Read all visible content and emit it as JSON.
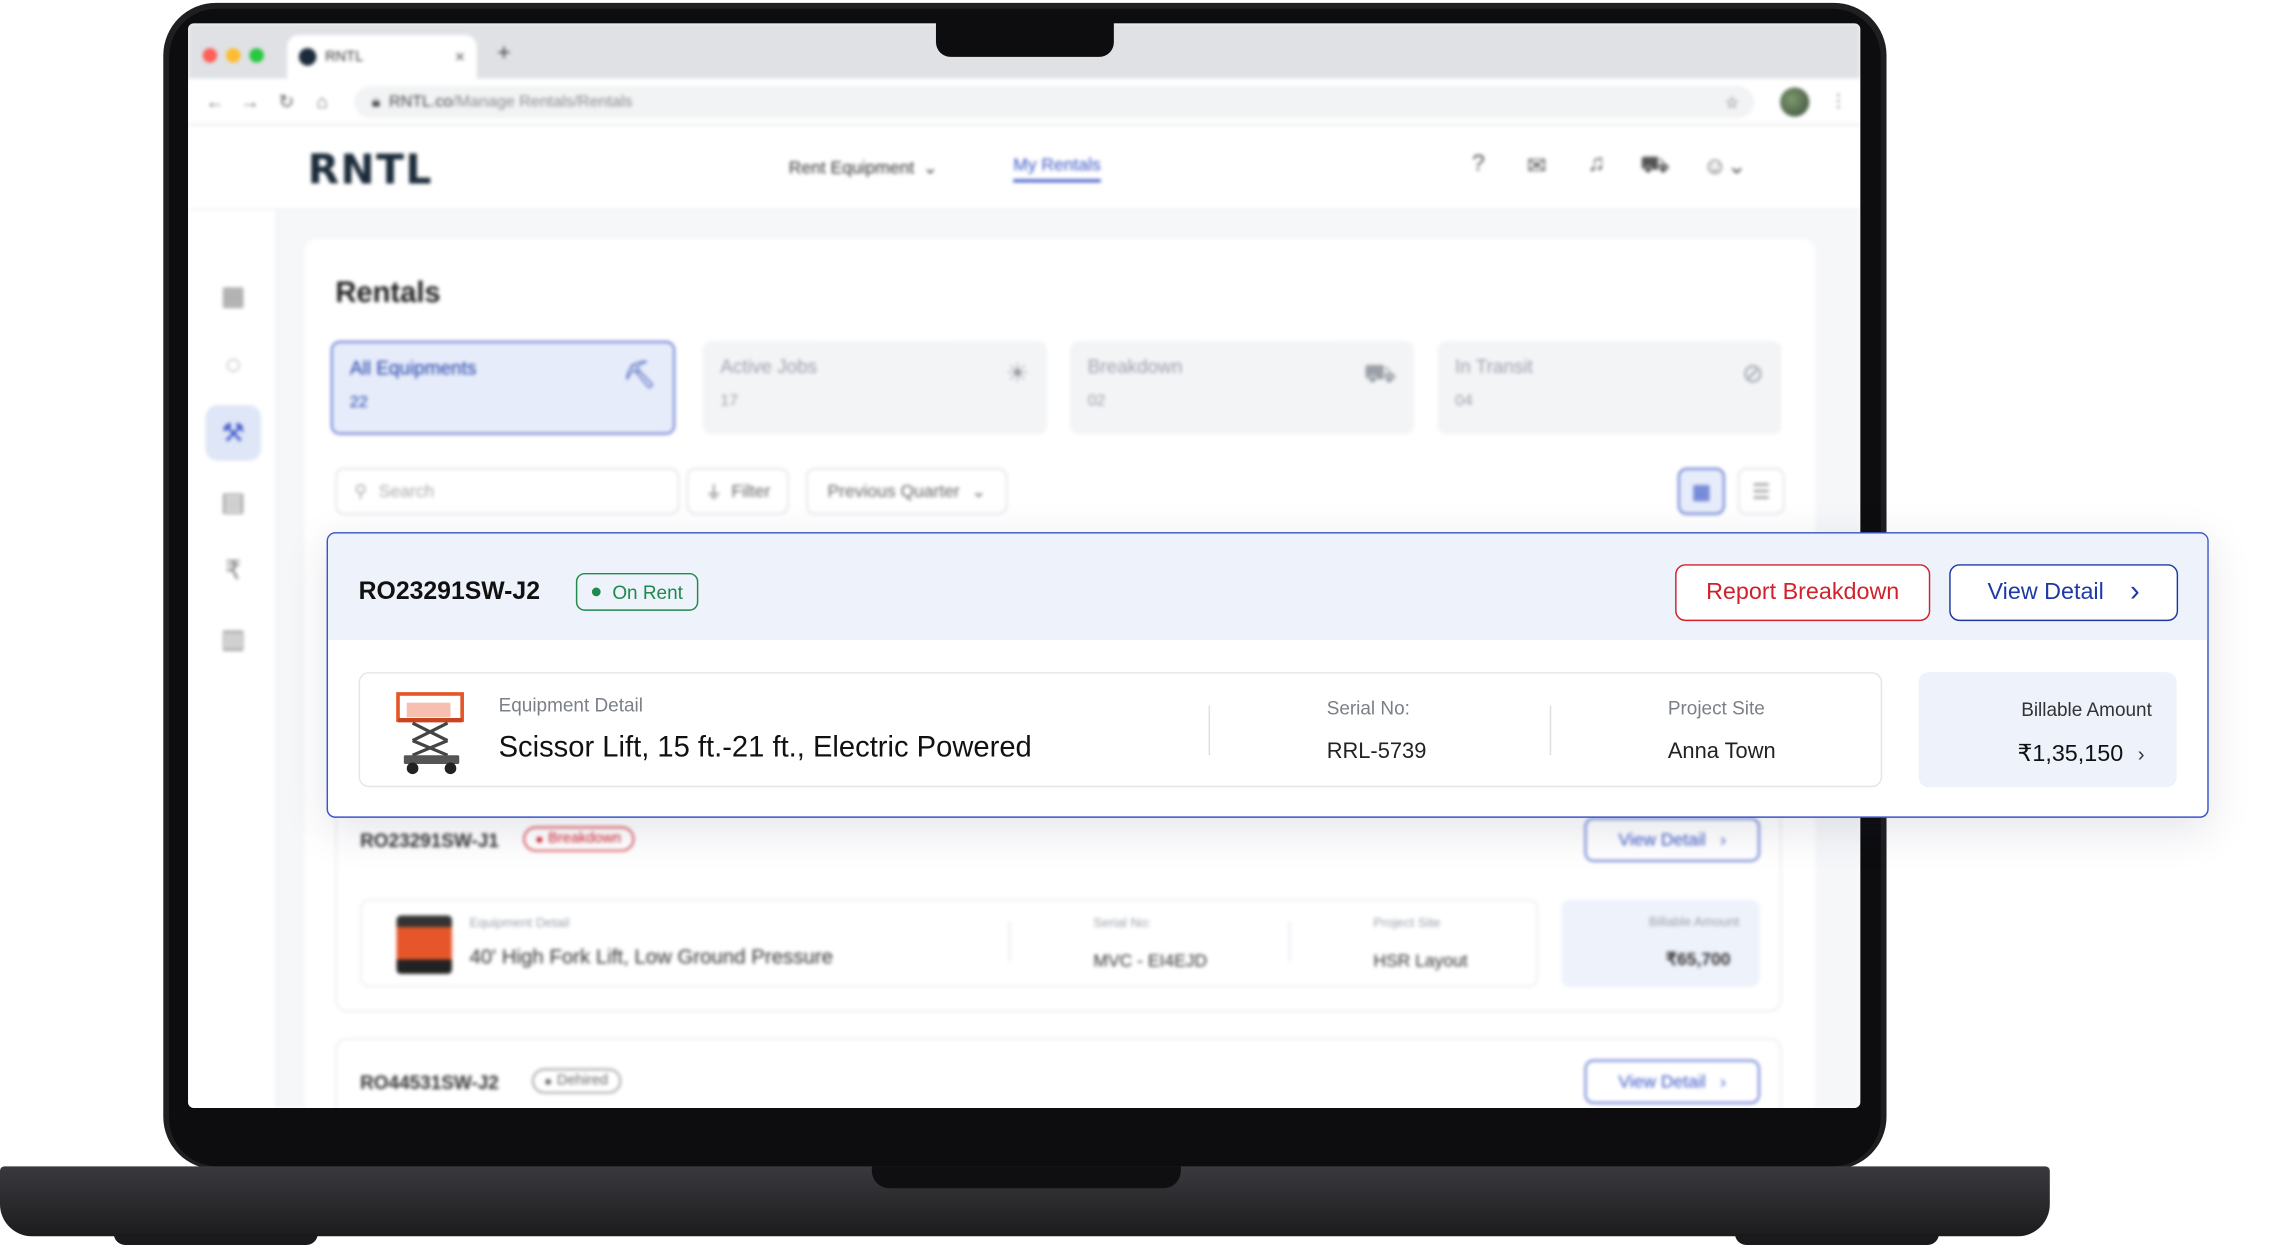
{
  "browser": {
    "tab_title": "RNTL",
    "tab_close": "×",
    "new_tab": "+",
    "url_domain": "RNTL.co",
    "url_path": "/Manage Rentals/Rentals"
  },
  "header": {
    "logo": "RNTL",
    "nav": [
      {
        "label": "Rent Equipment"
      },
      {
        "label": "My Rentals"
      }
    ],
    "icons": [
      "help-icon",
      "inbox-icon",
      "bell-icon",
      "cart-icon",
      "user-icon"
    ]
  },
  "page": {
    "title": "Rentals",
    "stats": [
      {
        "label": "All Equipments",
        "count": "22",
        "icon": "excavator-icon"
      },
      {
        "label": "Active Jobs",
        "count": "17",
        "icon": "bulb-icon"
      },
      {
        "label": "Breakdown",
        "count": "02",
        "icon": "truck-icon"
      },
      {
        "label": "In Transit",
        "count": "04",
        "icon": "ban-icon"
      }
    ],
    "search_placeholder": "Search",
    "filter_label": "Filter",
    "period_label": "Previous Quarter"
  },
  "rentals": [
    {
      "id": "RO23291SW-J2",
      "status": "On Rent",
      "report_label": "Report Breakdown",
      "view_label": "View Detail",
      "equipment_label": "Equipment Detail",
      "equipment_name": "Scissor Lift, 15 ft.-21 ft., Electric Powered",
      "serial_label": "Serial No:",
      "serial": "RRL-5739",
      "site_label": "Project Site",
      "site": "Anna Town",
      "bill_label": "Billable Amount",
      "bill": "₹1,35,150"
    },
    {
      "id": "RO23291SW-J1",
      "status": "Breakdown",
      "view_label": "View Detail",
      "equipment_label": "Equipment Detail",
      "equipment_name": "40' High Fork Lift, Low Ground Pressure",
      "serial_label": "Serial No:",
      "serial": "MVC - EI4EJD",
      "site_label": "Project Site",
      "site": "HSR Layout",
      "bill_label": "Billable Amount",
      "bill": "₹65,700"
    },
    {
      "id": "RO44531SW-J2",
      "status": "Dehired",
      "view_label": "View Detail"
    }
  ],
  "colors": {
    "accent": "#1d3aa6",
    "danger": "#d0212c",
    "success": "#1e8a4c"
  }
}
